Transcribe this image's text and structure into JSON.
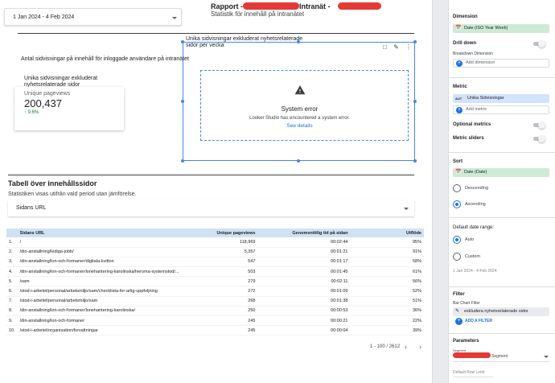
{
  "report": {
    "date_range": "1 Jan 2024 - 4 Feb 2024",
    "title_prefix": "Rapport -",
    "title_suffix": "Intranät -",
    "subtitle": "Statistik för innehåll på intranätet"
  },
  "scorecard_section": {
    "heading": "Antal sidvisningar på innehåll för inloggade användare på intranätet",
    "card_title": "Unika sidvisningar exkluderat nyhetsrelaterade sidor",
    "metric_label": "Unique pageviews",
    "metric_value": "200,437",
    "delta": "↑ 9.6%"
  },
  "chart": {
    "title": "Unika sidvisningar exkluderat nyhetsrelaterade sidor per vecka",
    "error_title": "System error",
    "error_message": "Looker Studio has encountered a system error.",
    "error_link": "See details"
  },
  "table_section": {
    "title": "Tabell över innehållssidor",
    "subtitle": "Statistiken visas utifrån vald period utan jämförelse.",
    "filter_label": "Sidans URL",
    "columns": [
      "Sidans URL",
      "Unique pageviews",
      "Genomsnittlig tid på sidan",
      "Utflöde"
    ],
    "rows": [
      {
        "n": "1.",
        "url": "/",
        "views": "118,969",
        "time": "00:02:44",
        "exit": "95%"
      },
      {
        "n": "2.",
        "url": "/din-anstallning/lediga-jobb/",
        "views": "5,357",
        "time": "00:01:21",
        "exit": "91%"
      },
      {
        "n": "3.",
        "url": "/din-anstallning/lon-och-formaner/digitala-kvitton",
        "views": "547",
        "time": "00:01:17",
        "exit": "58%"
      },
      {
        "n": "4.",
        "url": "/din-anstallning/lon-och-formaner/lonehantering-karolinska/heroma-systemstod/...",
        "views": "503",
        "time": "00:01:45",
        "exit": "61%"
      },
      {
        "n": "5.",
        "url": "/sam",
        "views": "279",
        "time": "00:02:11",
        "exit": "56%"
      },
      {
        "n": "6.",
        "url": "/stod-i-arbetet/personal/arbetsmiljo/sam/checklista-for-arlig-uppfoljning",
        "views": "272",
        "time": "00:01:09",
        "exit": "52%"
      },
      {
        "n": "7.",
        "url": "/stod-i-arbetet/personal/arbetsmiljo/sam",
        "views": "268",
        "time": "00:01:38",
        "exit": "51%"
      },
      {
        "n": "8.",
        "url": "/din-anstallning/lon-och-formaner/lonehantering-karolinska/",
        "views": "250",
        "time": "00:00:53",
        "exit": "36%"
      },
      {
        "n": "9.",
        "url": "/din-anstallning/lon-och-formaner",
        "views": "245",
        "time": "00:00:21",
        "exit": "22%"
      },
      {
        "n": "10.",
        "url": "/stod-i-arbetet/organisation/forvaltningar",
        "views": "245",
        "time": "00:00:04",
        "exit": "39%"
      }
    ],
    "pager": "1 - 100 / 2612"
  },
  "panel": {
    "dimension_label": "Dimension",
    "dimension_value": "Date (ISO Year Week)",
    "drill_down": "Drill down",
    "breakdown_label": "Breakdown Dimension",
    "add_dimension": "Add dimension",
    "metric_label": "Metric",
    "metric_type": "AUT",
    "metric_value": "Unika Sidvisningar",
    "add_metric": "Add metric",
    "optional_metrics": "Optional metrics",
    "metric_sliders": "Metric sliders",
    "sort_label": "Sort",
    "sort_value": "Date (Date)",
    "descending": "Descending",
    "ascending": "Ascending",
    "default_date_range": "Default date range:",
    "auto": "Auto",
    "custom": "Custom",
    "date_range_note": "1 Jan 2024 - 4 Feb 2024",
    "filter_label": "Filter",
    "bar_chart_filter": "Bar Chart Filter",
    "filter_value": "exkludera nyhetsrelaterade sidor",
    "add_filter": "ADD A FILTER",
    "parameters_label": "Parameters",
    "segment_small": "Segment",
    "segment_value": "Segment",
    "default_row_limit": "Default Row Limit"
  },
  "colors": {
    "accent": "#1a73e8",
    "redaction": "#e53935",
    "chip_green": "#ceead6",
    "chip_blue": "#d2e3fc",
    "table_header": "#cfe2f3"
  }
}
